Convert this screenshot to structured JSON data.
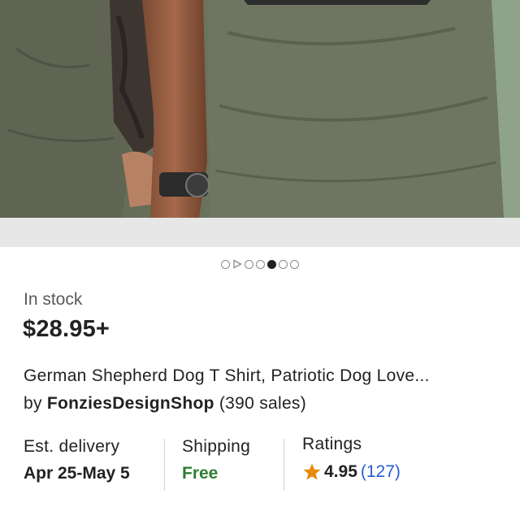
{
  "hero": {
    "image_alt": "Men wearing olive green t-shirts",
    "active_slide": 5,
    "total_slides": 7
  },
  "carousel": {
    "indicators": [
      {
        "type": "dot",
        "active": false
      },
      {
        "type": "play",
        "active": false
      },
      {
        "type": "dot",
        "active": false
      },
      {
        "type": "dot",
        "active": false
      },
      {
        "type": "dot",
        "active": true
      },
      {
        "type": "dot",
        "active": false
      },
      {
        "type": "dot",
        "active": false
      }
    ]
  },
  "product": {
    "stock_status": "In stock",
    "price": "$28.95+",
    "title": "German Shepherd Dog T Shirt, Patriotic Dog Love...",
    "by_prefix": "by ",
    "shop_name": "FonziesDesignShop",
    "sales": " (390 sales)"
  },
  "info": {
    "delivery_label": "Est. delivery",
    "delivery_value": "Apr 25-May 5",
    "shipping_label": "Shipping",
    "shipping_value": "Free",
    "ratings_label": "Ratings",
    "rating_value": "4.95",
    "rating_count": "(127)"
  },
  "colors": {
    "shirt": "#6d735c",
    "free_green": "#2f7d32",
    "link_blue": "#2a5bd7",
    "star": "#e58a0e"
  },
  "icons": {
    "rating": "star-icon",
    "video": "play-icon"
  }
}
